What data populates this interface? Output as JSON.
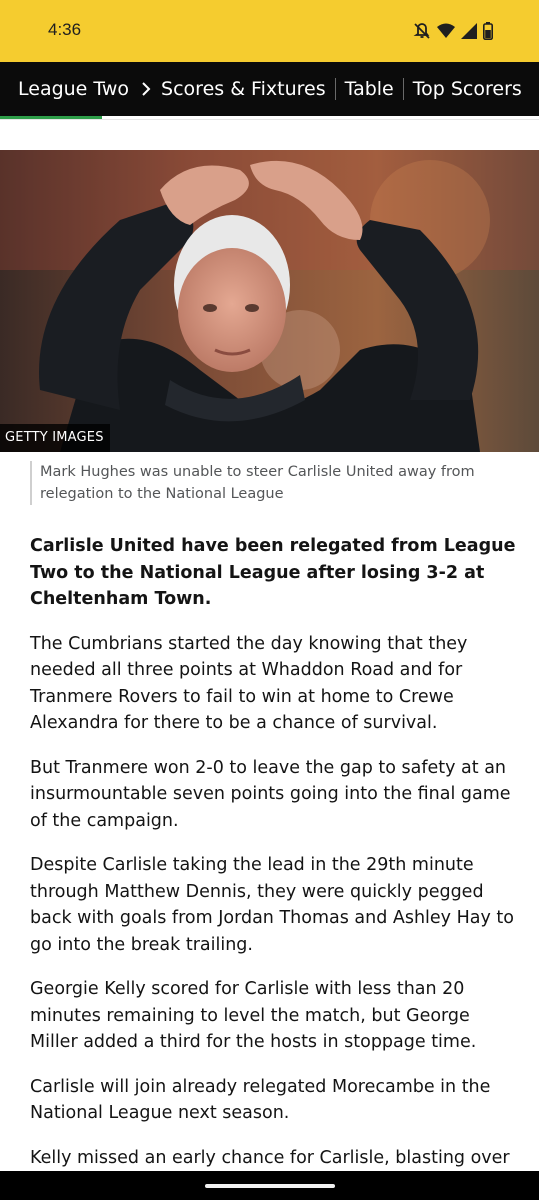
{
  "status_bar": {
    "time": "4:36",
    "icons": [
      "mute-icon",
      "wifi-icon",
      "signal-icon",
      "battery-icon"
    ],
    "background_color": "#f5cc2f"
  },
  "nav": {
    "breadcrumb": "League Two",
    "chevron_icon": "chevron-right-icon",
    "tabs": [
      "Scores & Fixtures",
      "Table",
      "Top Scorers"
    ],
    "accent_color": "#2e9e49"
  },
  "hero": {
    "credit": "GETTY IMAGES",
    "caption": "Mark Hughes was unable to steer Carlisle United away from relegation to the National League"
  },
  "article": {
    "lede": "Carlisle United have been relegated from League Two to the National League after losing 3-2 at Cheltenham Town.",
    "paragraphs": [
      "The Cumbrians started the day knowing that they needed all three points at Whaddon Road and for Tranmere Rovers to fail to win at home to Crewe Alexandra for there to be a chance of survival.",
      "But Tranmere won 2-0 to leave the gap to safety at an insurmountable seven points going into the final game of the campaign.",
      "Despite Carlisle taking the lead in the 29th minute through Matthew Dennis, they were quickly pegged back with goals from Jordan Thomas and Ashley Hay to go into the break trailing.",
      "Georgie Kelly scored for Carlisle with less than 20 minutes remaining to level the match, but George Miller added a third for the hosts in stoppage time.",
      "Carlisle will join already relegated Morecambe in the National League next season."
    ],
    "cut_off_line": "Kelly missed an early chance for Carlisle, blasting over"
  }
}
